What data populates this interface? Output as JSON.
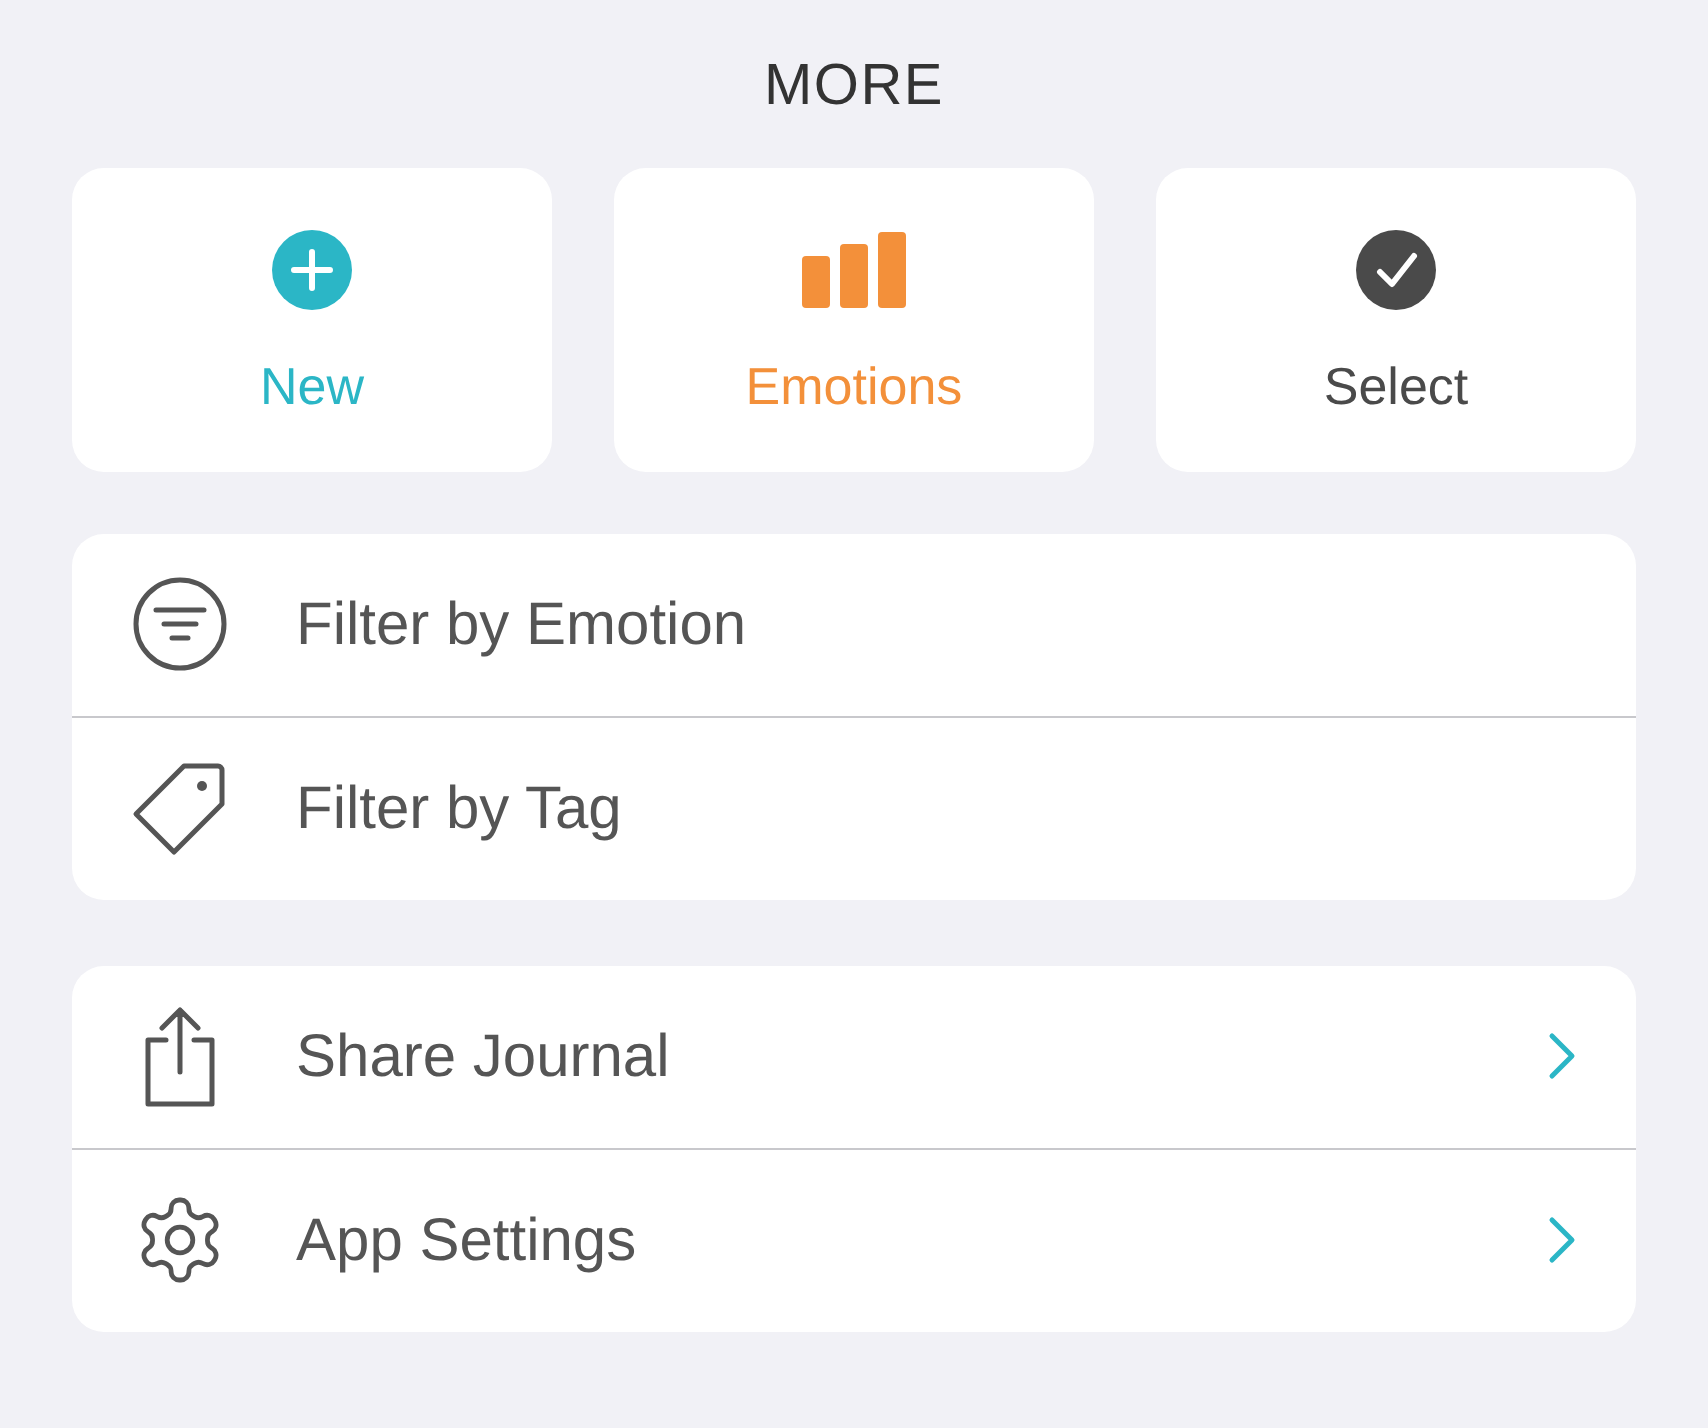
{
  "title": "MORE",
  "actions": [
    {
      "kind": "new",
      "label": "New",
      "color": "#2bb6c6"
    },
    {
      "kind": "emotions",
      "label": "Emotions",
      "color": "#f3903a"
    },
    {
      "kind": "select",
      "label": "Select",
      "color": "#4a4a4a"
    }
  ],
  "groups": [
    {
      "items": [
        {
          "kind": "filter",
          "label": "Filter by Emotion",
          "chevron": false
        },
        {
          "kind": "tag",
          "label": "Filter by Tag",
          "chevron": false
        }
      ]
    },
    {
      "items": [
        {
          "kind": "share",
          "label": "Share Journal",
          "chevron": true
        },
        {
          "kind": "settings",
          "label": "App Settings",
          "chevron": true
        }
      ]
    }
  ]
}
